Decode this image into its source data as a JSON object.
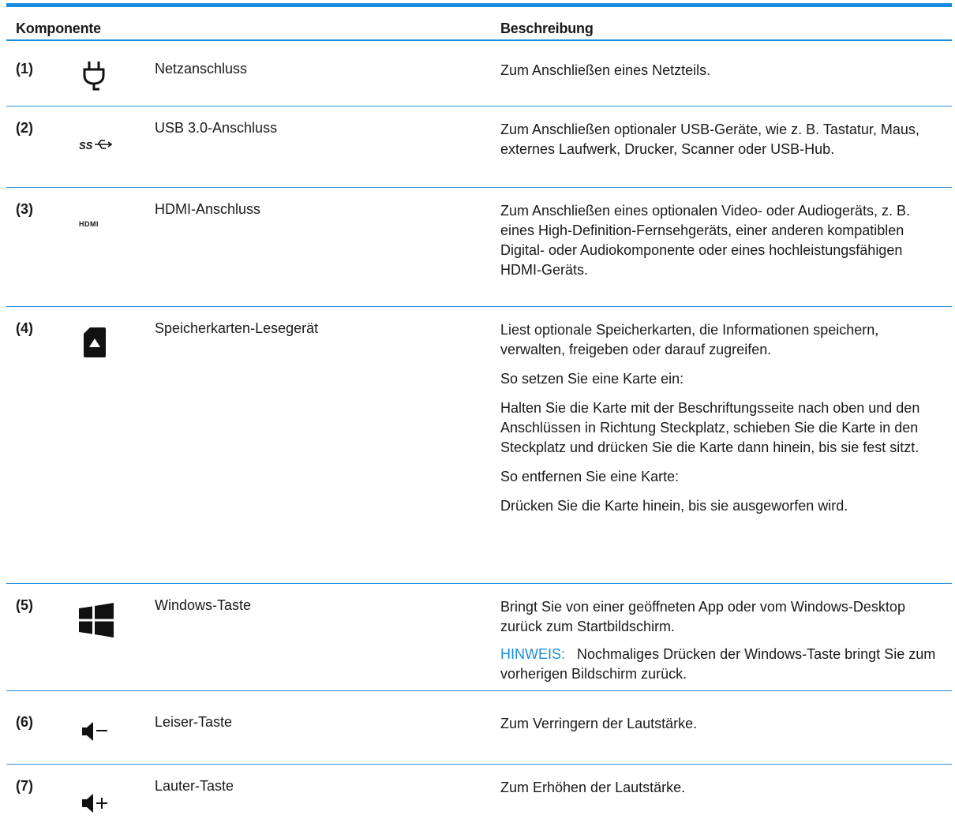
{
  "header": {
    "col_component": "Komponente",
    "col_description": "Beschreibung"
  },
  "rows": [
    {
      "num": "(1)",
      "icon": "power-plug-icon",
      "name": "Netzanschluss",
      "desc": [
        "Zum Anschließen eines Netzteils."
      ]
    },
    {
      "num": "(2)",
      "icon": "usb-superspeed-icon",
      "name": "USB 3.0-Anschluss",
      "desc": [
        "Zum Anschließen optionaler USB-Geräte, wie z. B. Tastatur, Maus, externes Laufwerk, Drucker, Scanner oder USB-Hub."
      ]
    },
    {
      "num": "(3)",
      "icon": "hdmi-icon",
      "name": "HDMI-Anschluss",
      "desc": [
        "Zum Anschließen eines optionalen Video- oder Audiogeräts, z. B. eines High-Definition-Fernsehgeräts, einer anderen kompatiblen Digital- oder Audiokomponente oder eines hochleistungsfähigen HDMI-Geräts."
      ]
    },
    {
      "num": "(4)",
      "icon": "memory-card-icon",
      "name": "Speicherkarten-Lesegerät",
      "desc": [
        "Liest optionale Speicherkarten, die Informationen speichern, verwalten, freigeben oder darauf zugreifen.",
        "So setzen Sie eine Karte ein:",
        "Halten Sie die Karte mit der Beschriftungsseite nach oben und den Anschlüssen in Richtung Steckplatz, schieben Sie die Karte in den Steckplatz und drücken Sie die Karte dann hinein, bis sie fest sitzt.",
        "So entfernen Sie eine Karte:",
        "Drücken Sie die Karte hinein, bis sie ausgeworfen wird."
      ]
    },
    {
      "num": "(5)",
      "icon": "windows-logo-icon",
      "name": "Windows-Taste",
      "desc": [
        "Bringt Sie von einer geöffneten App oder vom Windows-Desktop zurück zum Startbildschirm."
      ],
      "note_label": "HINWEIS:",
      "note_text": "Nochmaliges Drücken der Windows-Taste bringt Sie zum vorherigen Bildschirm zurück."
    },
    {
      "num": "(6)",
      "icon": "volume-down-icon",
      "name": "Leiser-Taste",
      "desc": [
        "Zum Verringern der Lautstärke."
      ]
    },
    {
      "num": "(7)",
      "icon": "volume-up-icon",
      "name": "Lauter-Taste",
      "desc": [
        "Zum Erhöhen der Lautstärke."
      ]
    }
  ],
  "colors": {
    "rule": "#1a8ce0",
    "note_label": "#1a8ce0"
  }
}
